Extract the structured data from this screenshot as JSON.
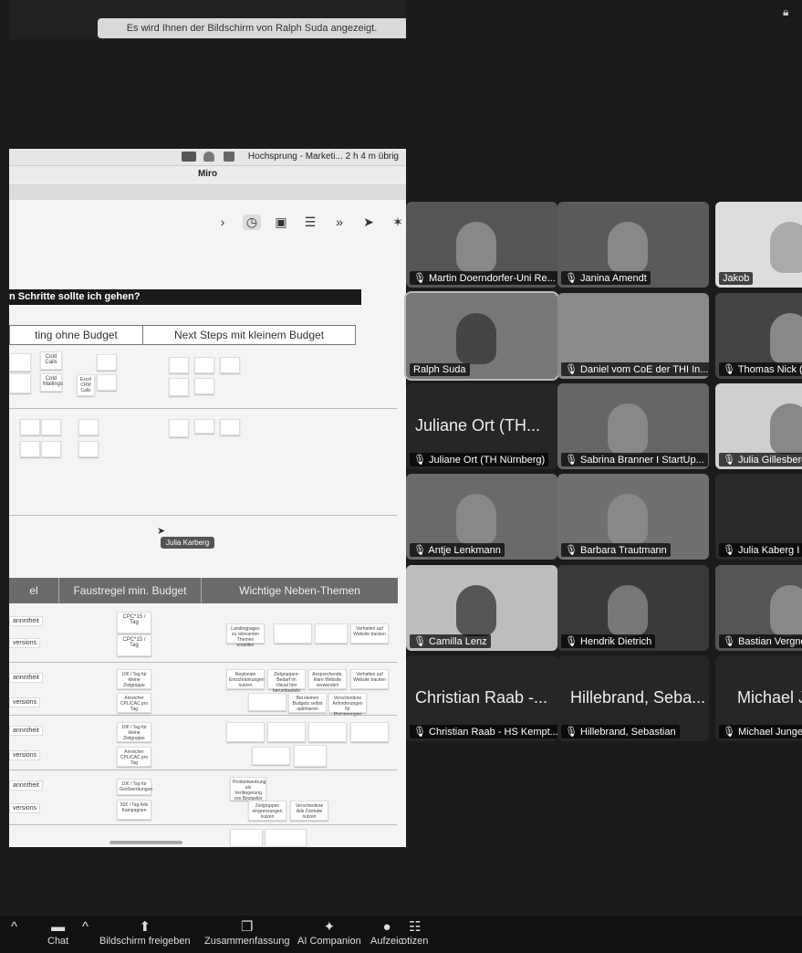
{
  "top": {
    "share_banner": "Es wird Ihnen der Bildschirm von Ralph Suda angezeigt."
  },
  "shared_screen": {
    "mac_menubar": "Hochsprung - Marketi... 2 h 4 m übrig",
    "app_title": "Miro",
    "question": "n Schritte sollte ich gehen?",
    "col_left_header": "ting ohne Budget",
    "col_right_header": "Next Steps mit kleinem Budget",
    "cursor_user": "Julia Karberg",
    "table_headers": [
      "el",
      "Faustregel min. Budget",
      "Wichtige Neben-Themen"
    ],
    "row_labels": [
      "annntheit",
      "versions",
      "annntheit",
      "versions",
      "annntheit",
      "versions",
      "annntheit",
      "versions"
    ],
    "stickies_left": [
      "Cold Calls",
      "Cold Mailings",
      "Excel CRM Calls"
    ],
    "budget_notes": [
      "CPC*15 / Tag",
      "CPC*15 / Tag",
      "10€ / Tag für kleine Zielgruppe",
      "Anreicher CPL/CAC pro Tag",
      "10€ / Tag für kleine Zielgruppe",
      "Anreicher CPL/CAC pro Tag",
      "10€ / Tag für Großwerbungen",
      "50€ / Tag Ads Kampagnen"
    ],
    "topic_notes": [
      "Landingpages zu relevanten Themen erstellen",
      "Verhalten auf Website tracken",
      "Regionale Einschränkungen nutzen",
      "Zielgruppen-Bedarf im Visual hier herumbasteln",
      "Ansprechende, klare Website verwenden",
      "Verhalten auf Website tracken",
      "Bei kleinen Budgets selbst optimieren",
      "Verschiedene Anforderungen für Platzierungen",
      "Produktwerbung als Verlängerung von Bestseller",
      "Zielgruppen eingrenzungen nutzen",
      "Verschiedene Ads Formate nutzen"
    ]
  },
  "participants": [
    {
      "name": "Martin Doerndorfer-Uni Re...",
      "muted": true
    },
    {
      "name": "Janina Amendt",
      "muted": true
    },
    {
      "name": "Jakob",
      "muted": false
    },
    {
      "name": "Ralph Suda",
      "muted": false
    },
    {
      "name": "Daniel vom CoE der THI In...",
      "muted": true
    },
    {
      "name": "Thomas Nick (H",
      "muted": true
    },
    {
      "name": "Juliane Ort (TH Nürnberg)",
      "muted": true,
      "display": "Juliane Ort (TH..."
    },
    {
      "name": "Sabrina Branner I StartUp...",
      "muted": true
    },
    {
      "name": "Julia Gillesberge",
      "muted": true
    },
    {
      "name": "Antje Lenkmann",
      "muted": true
    },
    {
      "name": "Barbara Trautmann",
      "muted": true
    },
    {
      "name": "Julia Kaberg I H",
      "muted": true
    },
    {
      "name": "Camilla Lenz",
      "muted": true
    },
    {
      "name": "Hendrik Dietrich",
      "muted": true
    },
    {
      "name": "Bastian Vergnor",
      "muted": true
    },
    {
      "name": "Christian Raab - HS Kempt...",
      "muted": true,
      "display": "Christian Raab -..."
    },
    {
      "name": "Hillebrand, Sebastian",
      "muted": true,
      "display": "Hillebrand, Seba..."
    },
    {
      "name": "Michael Junger",
      "muted": true,
      "display": "Michael J"
    }
  ],
  "toolbar": {
    "chat": "Chat",
    "share": "Bildschirm freigeben",
    "summary": "Zusammenfassung",
    "companion": "AI Companion",
    "record": "Aufzeic",
    "notes": "otizen"
  }
}
